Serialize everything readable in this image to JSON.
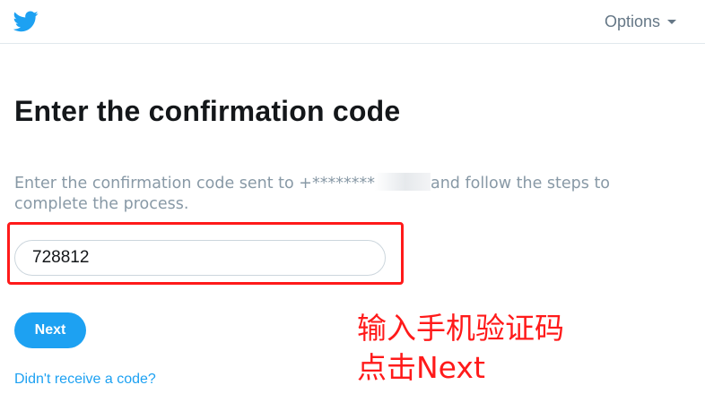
{
  "header": {
    "logo_icon": "twitter-bird-icon",
    "options_label": "Options",
    "options_icon": "caret-down-icon"
  },
  "main": {
    "title": "Enter the confirmation code",
    "description_before": "Enter the confirmation code sent to +********",
    "description_after": "and follow the steps to complete the process.",
    "code_input_value": "728812",
    "next_label": "Next",
    "resend_link": "Didn't receive a code?"
  },
  "annotation": {
    "line1": "输入手机验证码",
    "line2": "点击Next",
    "color": "#ff1a1a"
  },
  "colors": {
    "brand": "#1da1f2",
    "muted_text": "#8899a6",
    "heading": "#14171a",
    "divider": "#e1e8ed"
  }
}
